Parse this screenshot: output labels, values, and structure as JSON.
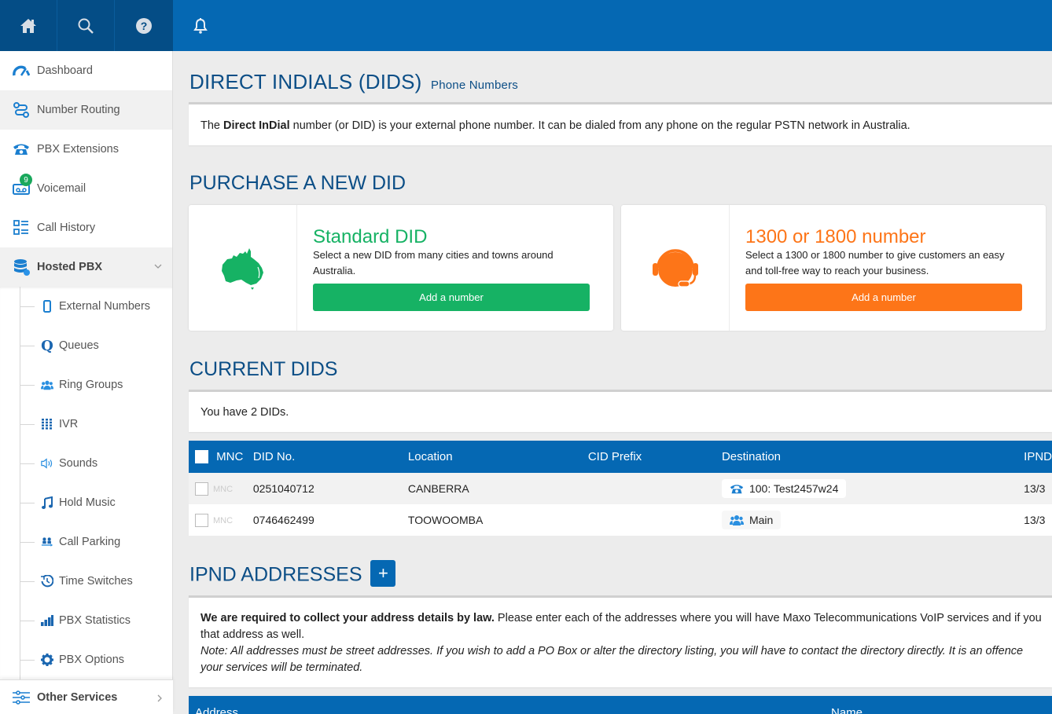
{
  "topbar": {
    "icons": [
      "home-icon",
      "search-icon",
      "help-icon",
      "bell-icon"
    ]
  },
  "sidebar": {
    "items": [
      {
        "label": "Dashboard",
        "icon": "dashboard-icon"
      },
      {
        "label": "Number Routing",
        "icon": "routing-icon",
        "active": true
      },
      {
        "label": "PBX Extensions",
        "icon": "phone-icon"
      },
      {
        "label": "Voicemail",
        "icon": "voicemail-icon",
        "badge": "9"
      },
      {
        "label": "Call History",
        "icon": "list-icon"
      },
      {
        "label": "Hosted PBX",
        "icon": "database-icon",
        "expanded": true
      }
    ],
    "subitems": [
      {
        "label": "External Numbers",
        "icon": "mobile-icon"
      },
      {
        "label": "Queues",
        "icon": "queue-icon"
      },
      {
        "label": "Ring Groups",
        "icon": "users-icon"
      },
      {
        "label": "IVR",
        "icon": "keypad-icon"
      },
      {
        "label": "Sounds",
        "icon": "speaker-icon"
      },
      {
        "label": "Hold Music",
        "icon": "music-icon"
      },
      {
        "label": "Call Parking",
        "icon": "parking-icon"
      },
      {
        "label": "Time Switches",
        "icon": "clock-icon"
      },
      {
        "label": "PBX Statistics",
        "icon": "bar-chart-icon"
      },
      {
        "label": "PBX Options",
        "icon": "gear-icon"
      }
    ],
    "other": {
      "label": "Other Services",
      "icon": "sliders-icon"
    }
  },
  "page": {
    "title": "DIRECT INDIALS (DIDS)",
    "subtitle": "Phone Numbers",
    "intro_pre": "The ",
    "intro_bold": "Direct InDial",
    "intro_post": " number (or DID) is your external phone number. It can be dialed from any phone on the regular PSTN network in Australia."
  },
  "purchase": {
    "heading": "PURCHASE A NEW DID",
    "cards": [
      {
        "title": "Standard DID",
        "desc": "Select a new DID from many cities and towns around Australia.",
        "button": "Add a number",
        "color": "#16b264",
        "icon": "australia-map-icon"
      },
      {
        "title": "1300 or 1800 number",
        "desc": "Select a 1300 or 1800 number to give customers an easy and toll-free way to reach your business.",
        "button": "Add a number",
        "color": "#fd7518",
        "icon": "headset-icon"
      }
    ]
  },
  "current": {
    "heading": "CURRENT DIDS",
    "count_text": "You have 2 DIDs.",
    "columns": [
      "MNC",
      "DID No.",
      "Location",
      "CID Prefix",
      "Destination",
      "IPND"
    ],
    "rows": [
      {
        "mnc": "MNC",
        "did": "0251040712",
        "location": "CANBERRA",
        "cid_prefix": "",
        "destination": "100: Test2457w24",
        "dest_icon": "phone-icon",
        "ipnd": "13/3"
      },
      {
        "mnc": "MNC",
        "did": "0746462499",
        "location": "TOOWOOMBA",
        "cid_prefix": "",
        "destination": "Main",
        "dest_icon": "users-icon",
        "ipnd": "13/3"
      }
    ]
  },
  "ipnd": {
    "heading": "IPND ADDRESSES",
    "add_label": "+",
    "law_bold": "We are required to collect your address details by law.",
    "law_text": " Please enter each of the addresses where you will have Maxo Telecommunications VoIP services and if you",
    "law_text2": "that address as well.",
    "note": "Note: All addresses must be street addresses. If you wish to add a PO Box or alter the directory listing, you will have to contact the directory directly. It is an offence",
    "note2": "your services will be terminated.",
    "columns": [
      "Address",
      "Name"
    ]
  },
  "colors": {
    "primary": "#0568b3",
    "dark": "#044d86",
    "green": "#16b264",
    "orange": "#fd7518",
    "heading": "#0c4e86"
  }
}
